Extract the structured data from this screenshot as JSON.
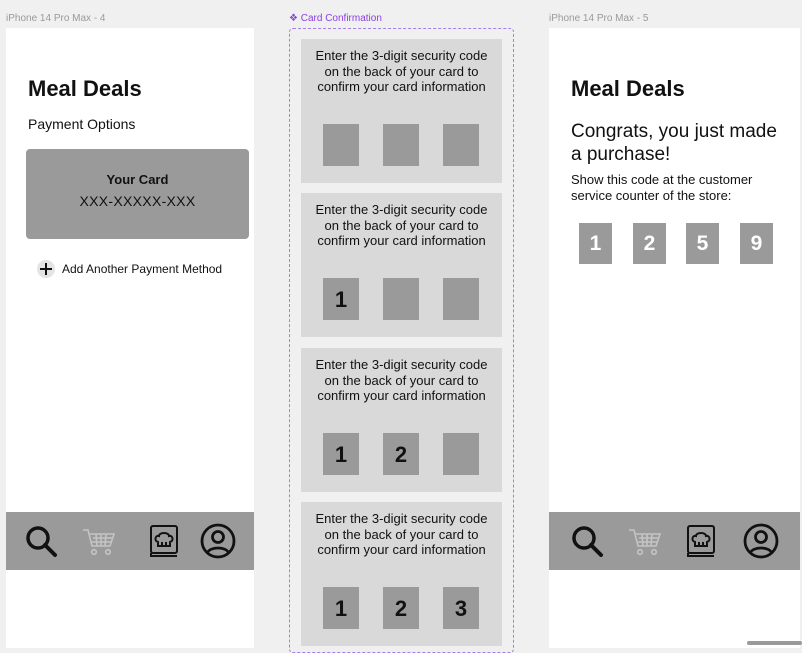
{
  "canvas": {
    "frame4_label": "iPhone 14 Pro Max - 4",
    "component_label": "❖ Card Confirmation",
    "frame5_label": "iPhone 14 Pro Max - 5"
  },
  "payment_screen": {
    "title": "Meal Deals",
    "subtitle": "Payment Options",
    "card_title": "Your Card",
    "card_number": "XXX-XXXXX-XXX",
    "add_method": "Add Another Payment Method"
  },
  "card_confirmation": {
    "prompt": "Enter the 3-digit security code on the back of your card to confirm your card information",
    "variants": [
      {
        "digits": [
          "",
          "",
          ""
        ]
      },
      {
        "digits": [
          "1",
          "",
          ""
        ]
      },
      {
        "digits": [
          "1",
          "2",
          ""
        ]
      },
      {
        "digits": [
          "1",
          "2",
          "3"
        ]
      }
    ]
  },
  "success_screen": {
    "title": "Meal Deals",
    "congrats": "Congrats, you just made a purchase!",
    "instructions": "Show this code at the customer service counter of the store:",
    "code_digits": [
      "1",
      "2",
      "5",
      "9"
    ]
  },
  "navbar": {
    "items": [
      "search-icon",
      "cart-icon",
      "recipe-book-icon",
      "profile-icon"
    ]
  },
  "colors": {
    "gray_dark": "#9a9a9a",
    "gray_light": "#d9d9d9",
    "component_accent": "#8b3ee8"
  }
}
